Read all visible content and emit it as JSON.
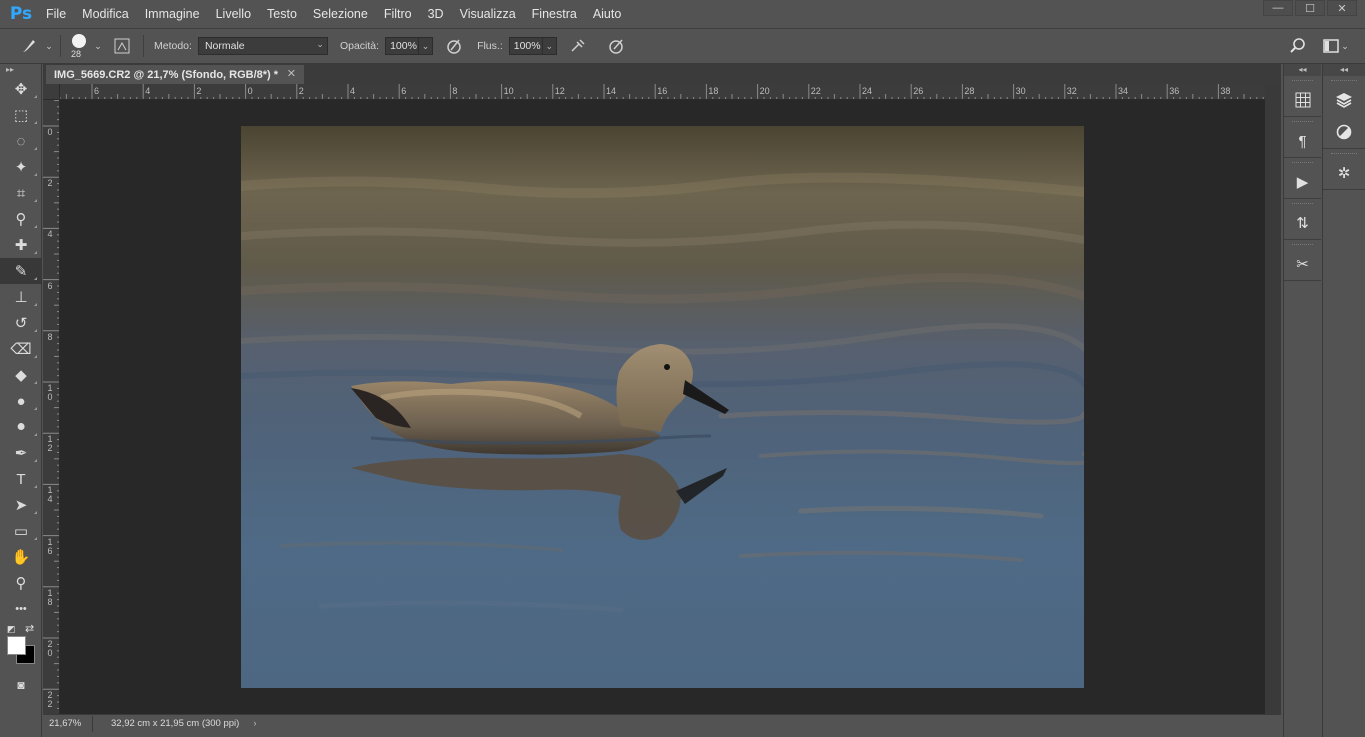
{
  "app": {
    "logo": "Ps",
    "menu": [
      "File",
      "Modifica",
      "Immagine",
      "Livello",
      "Testo",
      "Selezione",
      "Filtro",
      "3D",
      "Visualizza",
      "Finestra",
      "Aiuto"
    ],
    "window_controls": {
      "minimize": "—",
      "maximize": "☐",
      "close": "✕"
    }
  },
  "options": {
    "brush_size": "28",
    "metodo_label": "Metodo:",
    "metodo_value": "Normale",
    "opacita_label": "Opacità:",
    "opacita_value": "100%",
    "flusso_label": "Flus.:",
    "flusso_value": "100%"
  },
  "document": {
    "tab_title": "IMG_5669.CR2 @ 21,7% (Sfondo, RGB/8*) *",
    "close_glyph": "✕"
  },
  "rulers": {
    "top": [
      "6",
      "4",
      "2",
      "0",
      "2",
      "4",
      "6",
      "8",
      "10",
      "12",
      "14",
      "16",
      "18",
      "20",
      "22",
      "24",
      "26",
      "28",
      "30",
      "32",
      "34",
      "36",
      "38"
    ],
    "left": [
      "0",
      "2",
      "4",
      "6",
      "8",
      "1 0",
      "1 2",
      "1 4",
      "1 6",
      "1 8",
      "2 0",
      "2 2"
    ]
  },
  "status": {
    "zoom": "21,67%",
    "doc_size": "32,92 cm x 21,95 cm (300 ppi)",
    "arrow": "›"
  },
  "tools": [
    {
      "name": "move-tool",
      "glyph": "✥"
    },
    {
      "name": "marquee-tool",
      "glyph": "⬚"
    },
    {
      "name": "lasso-tool",
      "glyph": "◌"
    },
    {
      "name": "magic-wand-tool",
      "glyph": "✦"
    },
    {
      "name": "crop-tool",
      "glyph": "⌗"
    },
    {
      "name": "eyedropper-tool",
      "glyph": "⚲"
    },
    {
      "name": "healing-brush-tool",
      "glyph": "✚"
    },
    {
      "name": "brush-tool",
      "glyph": "✎"
    },
    {
      "name": "clone-stamp-tool",
      "glyph": "⊥"
    },
    {
      "name": "history-brush-tool",
      "glyph": "↺"
    },
    {
      "name": "eraser-tool",
      "glyph": "⌫"
    },
    {
      "name": "paint-bucket-tool",
      "glyph": "◆"
    },
    {
      "name": "blur-tool",
      "glyph": "●"
    },
    {
      "name": "dodge-tool",
      "glyph": "⚫"
    },
    {
      "name": "pen-tool",
      "glyph": "✒"
    },
    {
      "name": "type-tool",
      "glyph": "T"
    },
    {
      "name": "path-selection-tool",
      "glyph": "➤"
    },
    {
      "name": "rectangle-tool",
      "glyph": "▭"
    },
    {
      "name": "hand-tool",
      "glyph": "✋"
    },
    {
      "name": "zoom-tool",
      "glyph": "⚲"
    },
    {
      "name": "more-tools",
      "glyph": "•••"
    }
  ],
  "colors": {
    "foreground": "#ffffff",
    "background": "#000000",
    "ps_blue": "#31a8ff"
  },
  "dock_a": [
    "grid-icon",
    "paragraph-icon",
    "play-icon",
    "history-icon",
    "tools-icon"
  ],
  "dock_b": [
    "layers-icon",
    "adjustments-icon",
    "brush-settings-icon"
  ]
}
